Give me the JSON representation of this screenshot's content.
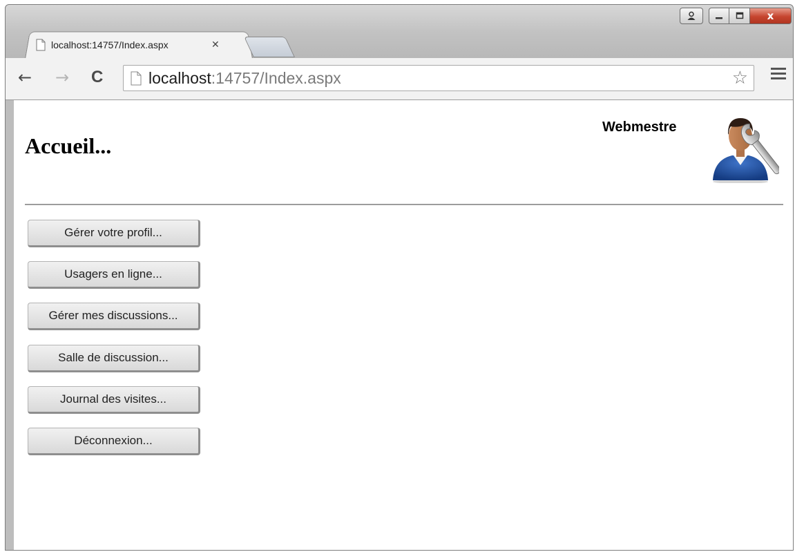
{
  "browser": {
    "tab_title": "localhost:14757/Index.aspx",
    "tab_close": "✕",
    "url_host": "localhost",
    "url_rest": ":14757/Index.aspx"
  },
  "icons": {
    "back": "←",
    "forward": "→",
    "reload": "C",
    "star": "☆",
    "user": "user-icon",
    "minimize": "minimize-icon",
    "maximize": "maximize-icon",
    "close": "x"
  },
  "page": {
    "title": "Accueil...",
    "role": "Webmestre",
    "menu": [
      "Gérer votre profil...",
      "Usagers en ligne...",
      "Gérer mes discussions...",
      "Salle de discussion...",
      "Journal des visites...",
      "Déconnexion..."
    ]
  },
  "colors": {
    "close_button": "#c6452f",
    "avatar_shirt": "#1f4e9c",
    "divider": "#9c9c9c"
  }
}
